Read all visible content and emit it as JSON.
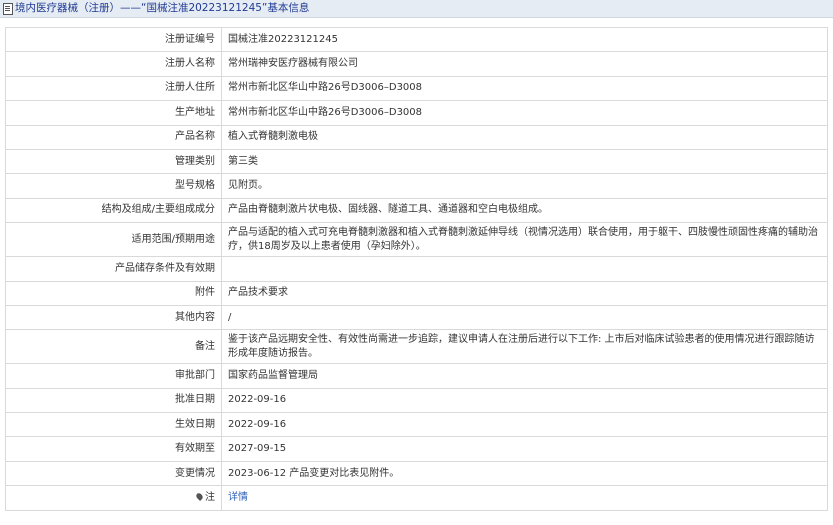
{
  "header": {
    "title": "境内医疗器械（注册）——“国械注准20223121245”基本信息"
  },
  "rows": [
    {
      "label": "注册证编号",
      "value": "国械注准20223121245"
    },
    {
      "label": "注册人名称",
      "value": "常州瑞神安医疗器械有限公司"
    },
    {
      "label": "注册人住所",
      "value": "常州市新北区华山中路26号D3006–D3008"
    },
    {
      "label": "生产地址",
      "value": "常州市新北区华山中路26号D3006–D3008"
    },
    {
      "label": "产品名称",
      "value": "植入式脊髓刺激电极"
    },
    {
      "label": "管理类别",
      "value": "第三类"
    },
    {
      "label": "型号规格",
      "value": "见附页。"
    },
    {
      "label": "结构及组成/主要组成成分",
      "value": "产品由脊髓刺激片状电极、固线器、隧道工具、通道器和空白电极组成。"
    },
    {
      "label": "适用范围/预期用途",
      "value": "产品与适配的植入式可充电脊髓刺激器和植入式脊髓刺激延伸导线（视情况选用）联合使用，用于躯干、四肢慢性顽固性疼痛的辅助治疗，供18周岁及以上患者使用（孕妇除外）。"
    },
    {
      "label": "产品储存条件及有效期",
      "value": ""
    },
    {
      "label": "附件",
      "value": "产品技术要求"
    },
    {
      "label": "其他内容",
      "value": "/"
    },
    {
      "label": "备注",
      "value": "鉴于该产品远期安全性、有效性尚需进一步追踪，建议申请人在注册后进行以下工作: 上市后对临床试验患者的使用情况进行跟踪随访形成年度随访报告。"
    },
    {
      "label": "审批部门",
      "value": "国家药品监督管理局"
    },
    {
      "label": "批准日期",
      "value": "2022-09-16"
    },
    {
      "label": "生效日期",
      "value": "2022-09-16"
    },
    {
      "label": "有效期至",
      "value": "2027-09-15"
    },
    {
      "label": "变更情况",
      "value": "2023-06-12 产品变更对比表见附件。"
    }
  ],
  "footer_row": {
    "label": "注",
    "icon": "pin-icon",
    "link": "详情"
  }
}
